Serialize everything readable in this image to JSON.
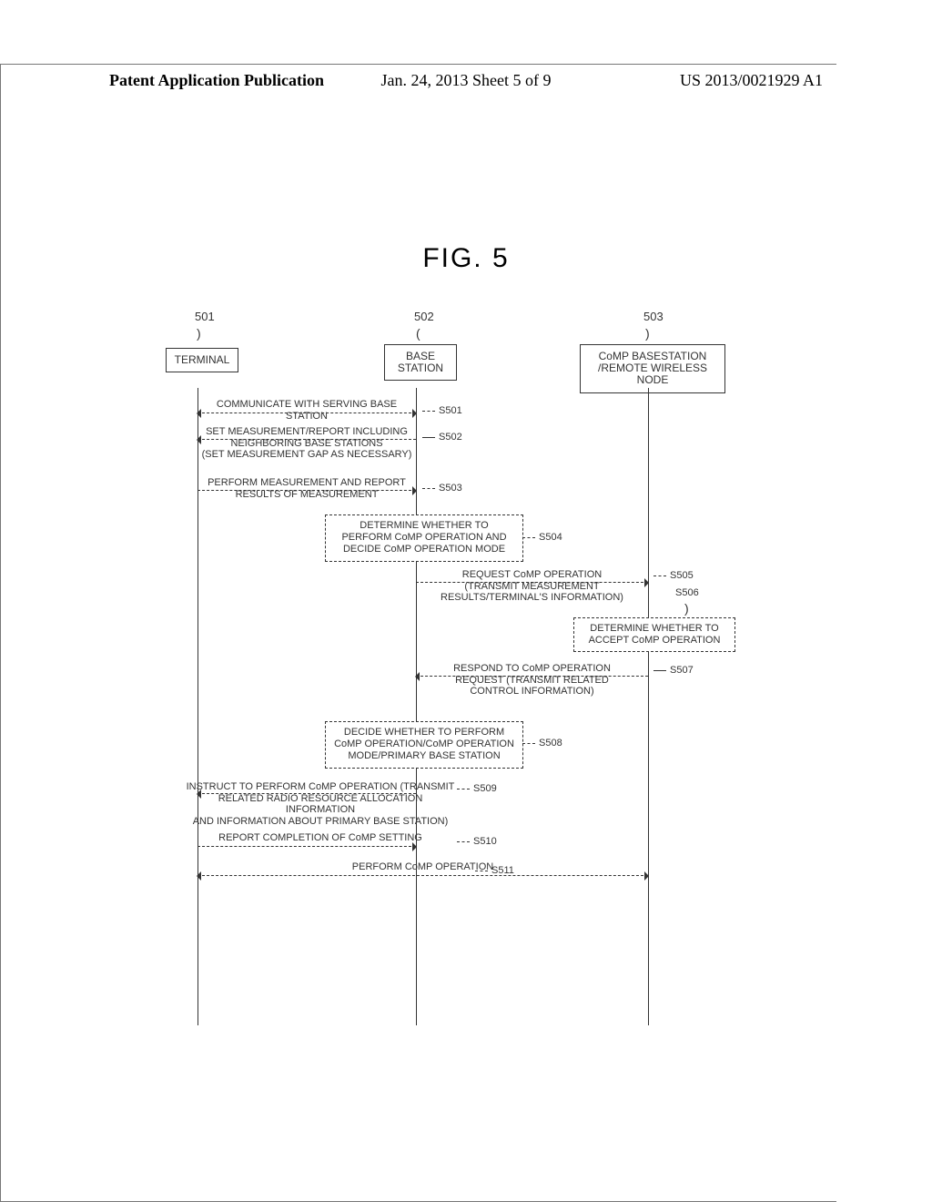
{
  "header": {
    "left": "Patent Application Publication",
    "mid": "Jan. 24, 2013  Sheet 5 of 9",
    "right": "US 2013/0021929 A1"
  },
  "figure_title": "FIG. 5",
  "participants": {
    "num_terminal": "501",
    "num_base": "502",
    "num_comp": "503",
    "terminal": "TERMINAL",
    "base": "BASE\nSTATION",
    "comp": "CoMP BASESTATION\n/REMOTE WIRELESS NODE"
  },
  "messages": {
    "s501": "COMMUNICATE WITH SERVING BASE STATION",
    "s502": "SET MEASUREMENT/REPORT INCLUDING\nNEIGHBORING BASE STATIONS\n(SET MEASUREMENT GAP AS NECESSARY)",
    "s503": "PERFORM MEASUREMENT AND REPORT\nRESULTS OF MEASUREMENT",
    "s504": "DETERMINE WHETHER TO\nPERFORM CoMP OPERATION AND\nDECIDE CoMP OPERATION MODE",
    "s505": "REQUEST CoMP OPERATION\n(TRANSMIT MEASUREMENT\nRESULTS/TERMINAL'S INFORMATION)",
    "s506": "DETERMINE WHETHER TO\nACCEPT CoMP OPERATION",
    "s507": "RESPOND TO CoMP OPERATION\nREQUEST (TRANSMIT RELATED\nCONTROL INFORMATION)",
    "s508": "DECIDE WHETHER TO PERFORM\nCoMP OPERATION/CoMP OPERATION\nMODE/PRIMARY BASE STATION",
    "s509": "INSTRUCT TO PERFORM CoMP OPERATION (TRANSMIT\nRELATED RADIO RESOURCE ALLOCATION INFORMATION\nAND INFORMATION ABOUT PRIMARY BASE STATION)",
    "s510": "REPORT COMPLETION OF CoMP SETTING",
    "s511": "PERFORM CoMP OPERATION"
  },
  "step_tags": {
    "s501": "S501",
    "s502": "S502",
    "s503": "S503",
    "s504": "S504",
    "s505": "S505",
    "s506_raw": "S506",
    "s507": "S507",
    "s508": "S508",
    "s509": "S509",
    "s510": "S510",
    "s511": "S511"
  },
  "chart_data": {
    "type": "sequence_diagram",
    "participants": [
      {
        "id": "501",
        "name": "TERMINAL"
      },
      {
        "id": "502",
        "name": "BASE STATION"
      },
      {
        "id": "503",
        "name": "CoMP BASESTATION / REMOTE WIRELESS NODE"
      }
    ],
    "steps": [
      {
        "step": "S501",
        "from": "501",
        "to": "502",
        "dir": "both",
        "text": "COMMUNICATE WITH SERVING BASE STATION"
      },
      {
        "step": "S502",
        "from": "502",
        "to": "501",
        "dir": "left",
        "text": "SET MEASUREMENT/REPORT INCLUDING NEIGHBORING BASE STATIONS (SET MEASUREMENT GAP AS NECESSARY)"
      },
      {
        "step": "S503",
        "from": "501",
        "to": "502",
        "dir": "right",
        "text": "PERFORM MEASUREMENT AND REPORT RESULTS OF MEASUREMENT"
      },
      {
        "step": "S504",
        "at": "502",
        "type": "process",
        "text": "DETERMINE WHETHER TO PERFORM CoMP OPERATION AND DECIDE CoMP OPERATION MODE"
      },
      {
        "step": "S505",
        "from": "502",
        "to": "503",
        "dir": "right",
        "text": "REQUEST CoMP OPERATION (TRANSMIT MEASUREMENT RESULTS/TERMINAL'S INFORMATION)"
      },
      {
        "step": "S506",
        "at": "503",
        "type": "process",
        "text": "DETERMINE WHETHER TO ACCEPT CoMP OPERATION"
      },
      {
        "step": "S507",
        "from": "503",
        "to": "502",
        "dir": "left",
        "text": "RESPOND TO CoMP OPERATION REQUEST (TRANSMIT RELATED CONTROL INFORMATION)"
      },
      {
        "step": "S508",
        "at": "502",
        "type": "process",
        "text": "DECIDE WHETHER TO PERFORM CoMP OPERATION/CoMP OPERATION MODE/PRIMARY BASE STATION"
      },
      {
        "step": "S509",
        "from": "502",
        "to": "501",
        "dir": "left",
        "text": "INSTRUCT TO PERFORM CoMP OPERATION (TRANSMIT RELATED RADIO RESOURCE ALLOCATION INFORMATION AND INFORMATION ABOUT PRIMARY BASE STATION)"
      },
      {
        "step": "S510",
        "from": "501",
        "to": "502",
        "dir": "right",
        "text": "REPORT COMPLETION OF CoMP SETTING"
      },
      {
        "step": "S511",
        "from": "501",
        "to": "503",
        "dir": "both",
        "text": "PERFORM CoMP OPERATION"
      }
    ]
  }
}
